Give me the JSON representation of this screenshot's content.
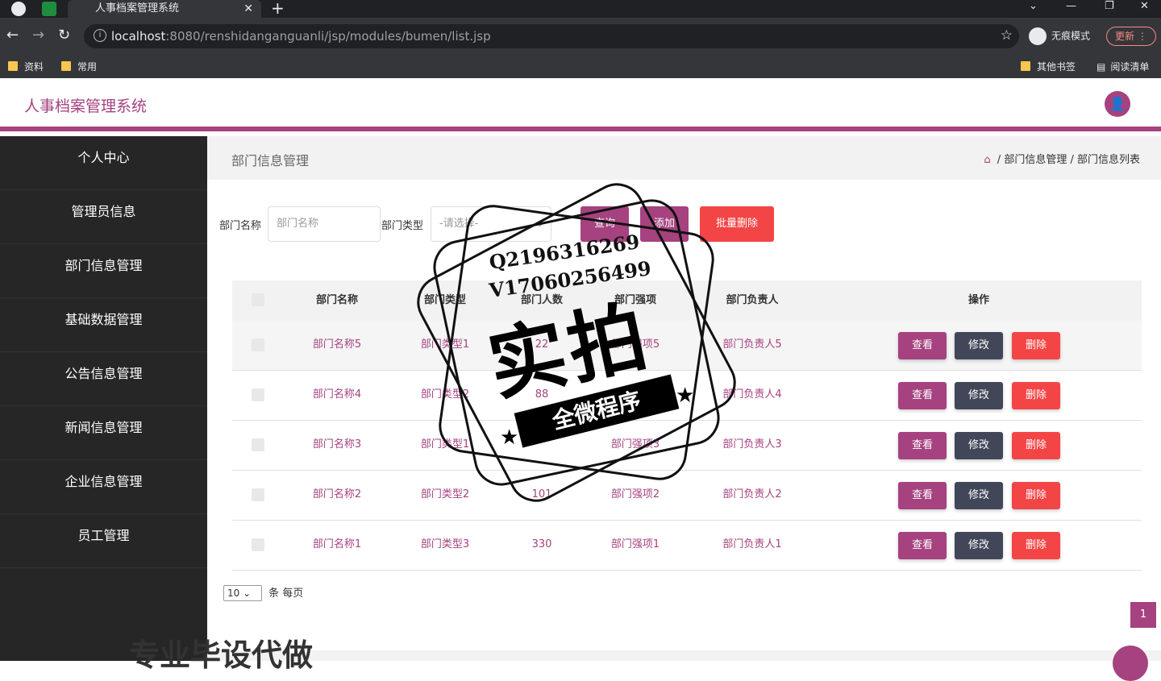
{
  "browser": {
    "tab_title": "人事档案管理系统",
    "url_host": "localhost",
    "url_rest": ":8080/renshidanganguanli/jsp/modules/bumen/list.jsp",
    "incognito_label": "无痕模式",
    "update_label": "更新",
    "bookmarks": [
      "资料",
      "常用"
    ],
    "bookmarks_right": [
      "其他书签",
      "阅读清单"
    ]
  },
  "app": {
    "title": "人事档案管理系统",
    "accent": "#a5427f"
  },
  "sidebar": {
    "items": [
      "个人中心",
      "管理员信息",
      "部门信息管理",
      "基础数据管理",
      "公告信息管理",
      "新闻信息管理",
      "企业信息管理",
      "员工管理"
    ]
  },
  "page": {
    "title": "部门信息管理",
    "breadcrumb": [
      "部门信息管理",
      "部门信息列表"
    ]
  },
  "filters": {
    "name_label": "部门名称",
    "name_placeholder": "部门名称",
    "type_label": "部门类型",
    "type_placeholder": "-请选择-",
    "search": "查询",
    "add": "添加",
    "batch_delete": "批量删除"
  },
  "table": {
    "headers": [
      "部门名称",
      "部门类型",
      "部门人数",
      "部门强项",
      "部门负责人",
      "操作"
    ],
    "rows": [
      {
        "name": "部门名称5",
        "type": "部门类型1",
        "count": "22",
        "strength": "部门强项5",
        "head": "部门负责人5"
      },
      {
        "name": "部门名称4",
        "type": "部门类型2",
        "count": "88",
        "strength": "部门强项4",
        "head": "部门负责人4"
      },
      {
        "name": "部门名称3",
        "type": "部门类型1",
        "count": "",
        "strength": "部门强项3",
        "head": "部门负责人3"
      },
      {
        "name": "部门名称2",
        "type": "部门类型2",
        "count": "101",
        "strength": "部门强项2",
        "head": "部门负责人2"
      },
      {
        "name": "部门名称1",
        "type": "部门类型3",
        "count": "330",
        "strength": "部门强项1",
        "head": "部门负责人1"
      }
    ],
    "actions": {
      "view": "查看",
      "edit": "修改",
      "delete": "删除"
    }
  },
  "pager": {
    "page_size": "10",
    "per_page_label": "条 每页",
    "current_page": "1"
  },
  "watermark": {
    "qq": "Q2196316269",
    "vx": "V17060256499",
    "big": "实拍",
    "band": "全微程序",
    "bottom": "专业毕设代做"
  }
}
